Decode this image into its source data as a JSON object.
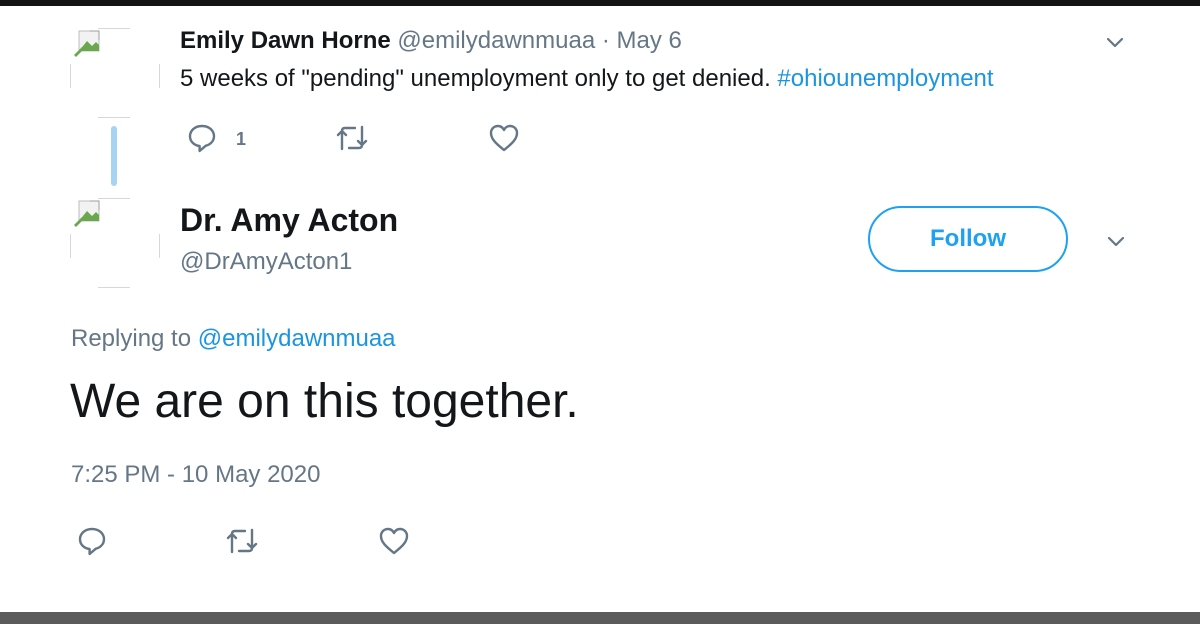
{
  "tweet1": {
    "author_name": "Emily Dawn Horne",
    "author_handle": "@emilydawnmuaa",
    "separator": "·",
    "date": "May 6",
    "text_main": "5 weeks of \"pending\" unemployment only to get denied. ",
    "hashtag": "#ohiounemployment",
    "reply_count": "1",
    "icons": [
      "reply-icon",
      "retweet-icon",
      "like-icon",
      "chevron-down-icon"
    ]
  },
  "tweet2": {
    "author_name": "Dr. Amy Acton",
    "author_handle": "@DrAmyActon1",
    "follow_label": "Follow",
    "replying_prefix": "Replying to ",
    "replying_handle": "@emilydawnmuaa",
    "text": "We are on this together.",
    "timestamp": "7:25 PM - 10 May 2020",
    "icons": [
      "reply-icon",
      "retweet-icon",
      "like-icon",
      "chevron-down-icon"
    ]
  },
  "colors": {
    "link": "#1b95e0",
    "follow_accent": "#1da1f2",
    "secondary_text": "#657786",
    "primary_text": "#14171a",
    "thread_line": "#a7d4f3"
  }
}
